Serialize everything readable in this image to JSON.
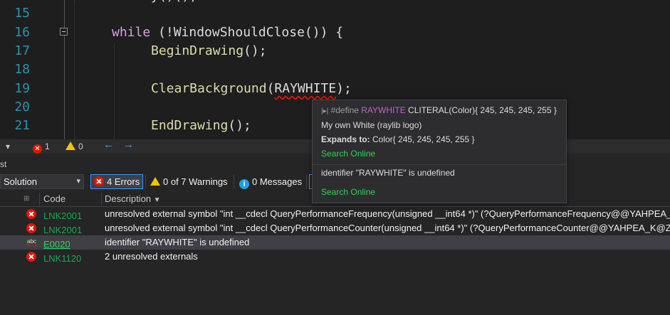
{
  "editor": {
    "lines": [
      {
        "num": "15",
        "text": ""
      },
      {
        "num": "16",
        "kw": "while",
        "rest": " (!WindowShouldClose()) {"
      },
      {
        "num": "17",
        "fn": "BeginDrawing",
        "rest": "();"
      },
      {
        "num": "18",
        "text": ""
      },
      {
        "num": "19",
        "fn": "ClearBackground",
        "open": "(",
        "macro": "RAYWHITE",
        "close": ");"
      },
      {
        "num": "20",
        "text": ""
      },
      {
        "num": "21",
        "fn": "EndDrawing",
        "rest": "();"
      }
    ],
    "partial_top": "y()();"
  },
  "status_strip": {
    "errors": "1",
    "warnings": "0",
    "back_arrow": "←",
    "forward_arrow": "→"
  },
  "tooltip": {
    "define_prefix": "#define ",
    "macro_name": "RAYWHITE",
    "macro_expr": " CLITERAL(Color){ 245, 245, 245, 255 }",
    "description": "My own White (raylib logo)",
    "expands_label": "Expands to:",
    "expands_value": " Color{ 245, 245, 245, 255 }",
    "search_online_1": "Search Online",
    "error_text": "identifier \"RAYWHITE\" is undefined",
    "search_online_2": "Search Online"
  },
  "error_list": {
    "title": "st",
    "scope": "Solution",
    "errors_filter": "4 Errors",
    "warnings_filter": "0 of 7 Warnings",
    "messages_filter": "0 Messages",
    "columns": {
      "code": "Code",
      "description": "Description"
    },
    "rows": [
      {
        "code": "LNK2001",
        "description": "unresolved external symbol \"int __cdecl QueryPerformanceFrequency(unsigned __int64 *)\" (?QueryPerformanceFrequency@@YAHPEA_K@Z)"
      },
      {
        "code": "LNK2001",
        "description": "unresolved external symbol \"int __cdecl QueryPerformanceCounter(unsigned __int64 *)\" (?QueryPerformanceCounter@@YAHPEA_K@Z)"
      },
      {
        "code": "E0020",
        "description": "identifier \"RAYWHITE\" is undefined"
      },
      {
        "code": "LNK1120",
        "description": "2 unresolved externals"
      }
    ]
  }
}
